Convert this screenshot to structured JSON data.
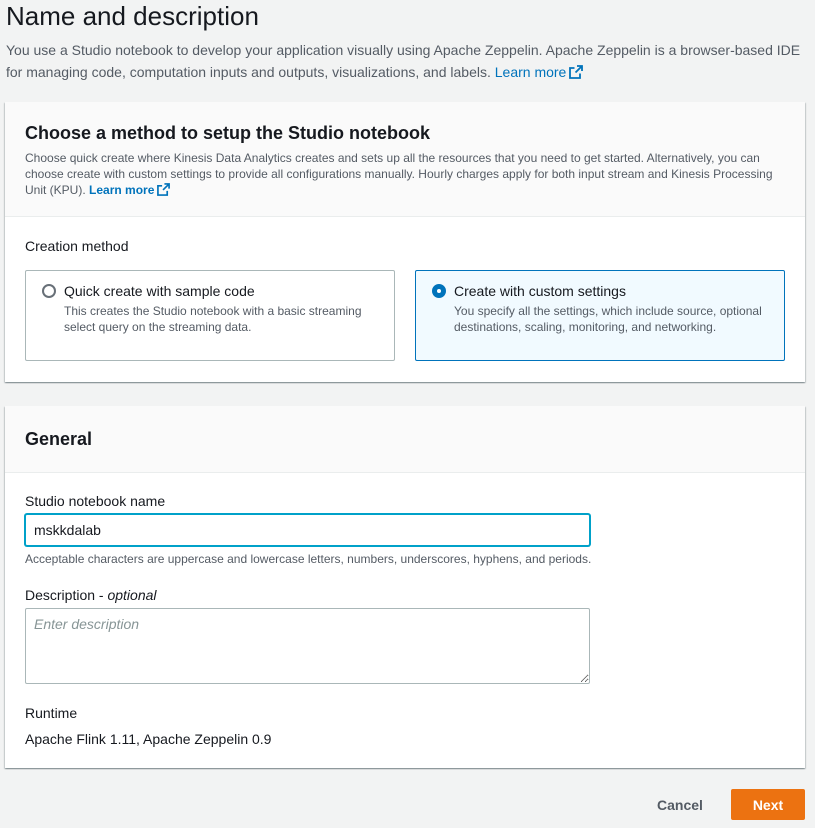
{
  "page": {
    "title": "Name and description",
    "description": "You use a Studio notebook to develop your application visually using Apache Zeppelin. Apache Zeppelin is a browser-based IDE for managing code, computation inputs and outputs, visualizations, and labels.",
    "learn_more": "Learn more"
  },
  "method_card": {
    "title": "Choose a method to setup the Studio notebook",
    "description": "Choose quick create where Kinesis Data Analytics creates and sets up all the resources that you need to get started. Alternatively, you can choose create with custom settings to provide all configurations manually. Hourly charges apply for both input stream and Kinesis Processing Unit (KPU).",
    "learn_more": "Learn more",
    "creation_method_label": "Creation method",
    "options": [
      {
        "title": "Quick create with sample code",
        "description": "This creates the Studio notebook with a basic streaming select query on the streaming data.",
        "selected": false
      },
      {
        "title": "Create with custom settings",
        "description": "You specify all the settings, which include source, optional destinations, scaling, monitoring, and networking.",
        "selected": true
      }
    ]
  },
  "general_card": {
    "title": "General",
    "name_label": "Studio notebook name",
    "name_value": "mskkdalab",
    "name_hint": "Acceptable characters are uppercase and lowercase letters, numbers, underscores, hyphens, and periods.",
    "description_label": "Description - ",
    "description_optional": "optional",
    "description_placeholder": "Enter description",
    "description_value": "",
    "runtime_label": "Runtime",
    "runtime_value": "Apache Flink 1.11, Apache Zeppelin 0.9"
  },
  "footer": {
    "cancel_label": "Cancel",
    "next_label": "Next"
  },
  "colors": {
    "accent": "#0073bb",
    "primary_button": "#ec7211",
    "focus_border": "#00a1c9"
  },
  "icons": {
    "learn_more": "external-link-icon"
  }
}
